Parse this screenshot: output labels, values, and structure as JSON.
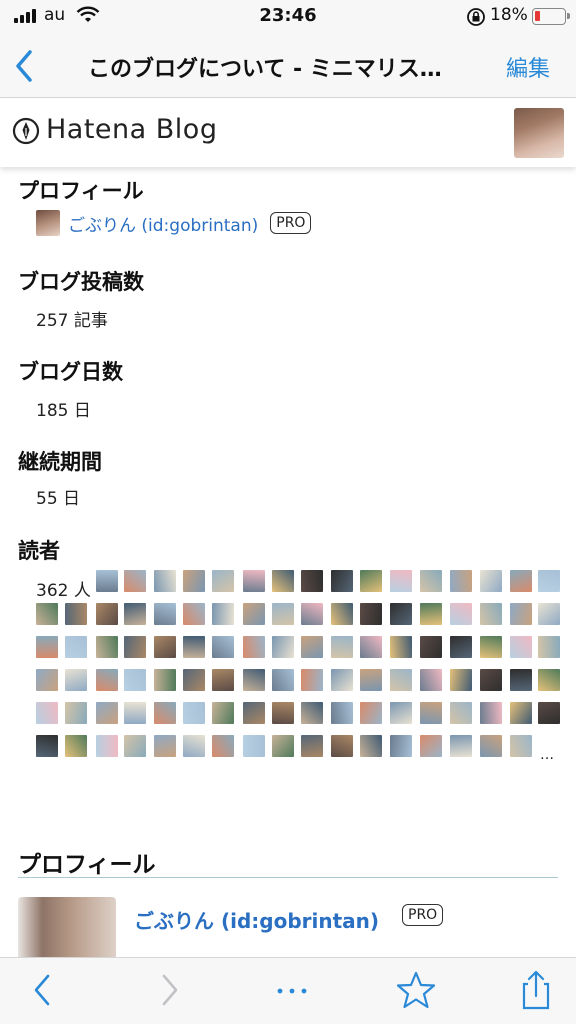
{
  "status_bar": {
    "carrier": "au",
    "time": "23:46",
    "battery_percent": "18%",
    "battery_level": 0.18,
    "signal_icon": "signal-bars-icon",
    "wifi_icon": "wifi-icon",
    "lock_icon": "orientation-lock-icon"
  },
  "navbar": {
    "title": "このブログについて - ミニマリス…",
    "edit_label": "編集",
    "back_icon": "chevron-left-icon"
  },
  "header": {
    "logo_text": "Hatena Blog",
    "logo_icon": "hatena-pen-icon"
  },
  "sections": {
    "profile_heading": "プロフィール",
    "profile_name": "ごぶりん (id:gobrintan)",
    "pro_badge": "PRO",
    "posts_heading": "ブログ投稿数",
    "posts_value": "257 記事",
    "days_heading": "ブログ日数",
    "days_value": "185 日",
    "period_heading": "継続期間",
    "period_value": "55 日",
    "readers_heading": "読者",
    "readers_count": "362 人",
    "readers_more": "…"
  },
  "profile_card": {
    "heading": "プロフィール",
    "name": "ごぶりん (id:gobrintan)",
    "badge": "PRO"
  },
  "toolbar": {
    "back_icon": "chevron-left-icon",
    "forward_icon": "chevron-right-icon",
    "more_icon": "more-dots-icon",
    "bookmark_icon": "star-icon",
    "share_icon": "share-icon"
  },
  "colors": {
    "accent": "#2a8ad8",
    "link": "#2a6fc2",
    "battery_low": "#e53935",
    "rule": "#a9cbd0"
  }
}
